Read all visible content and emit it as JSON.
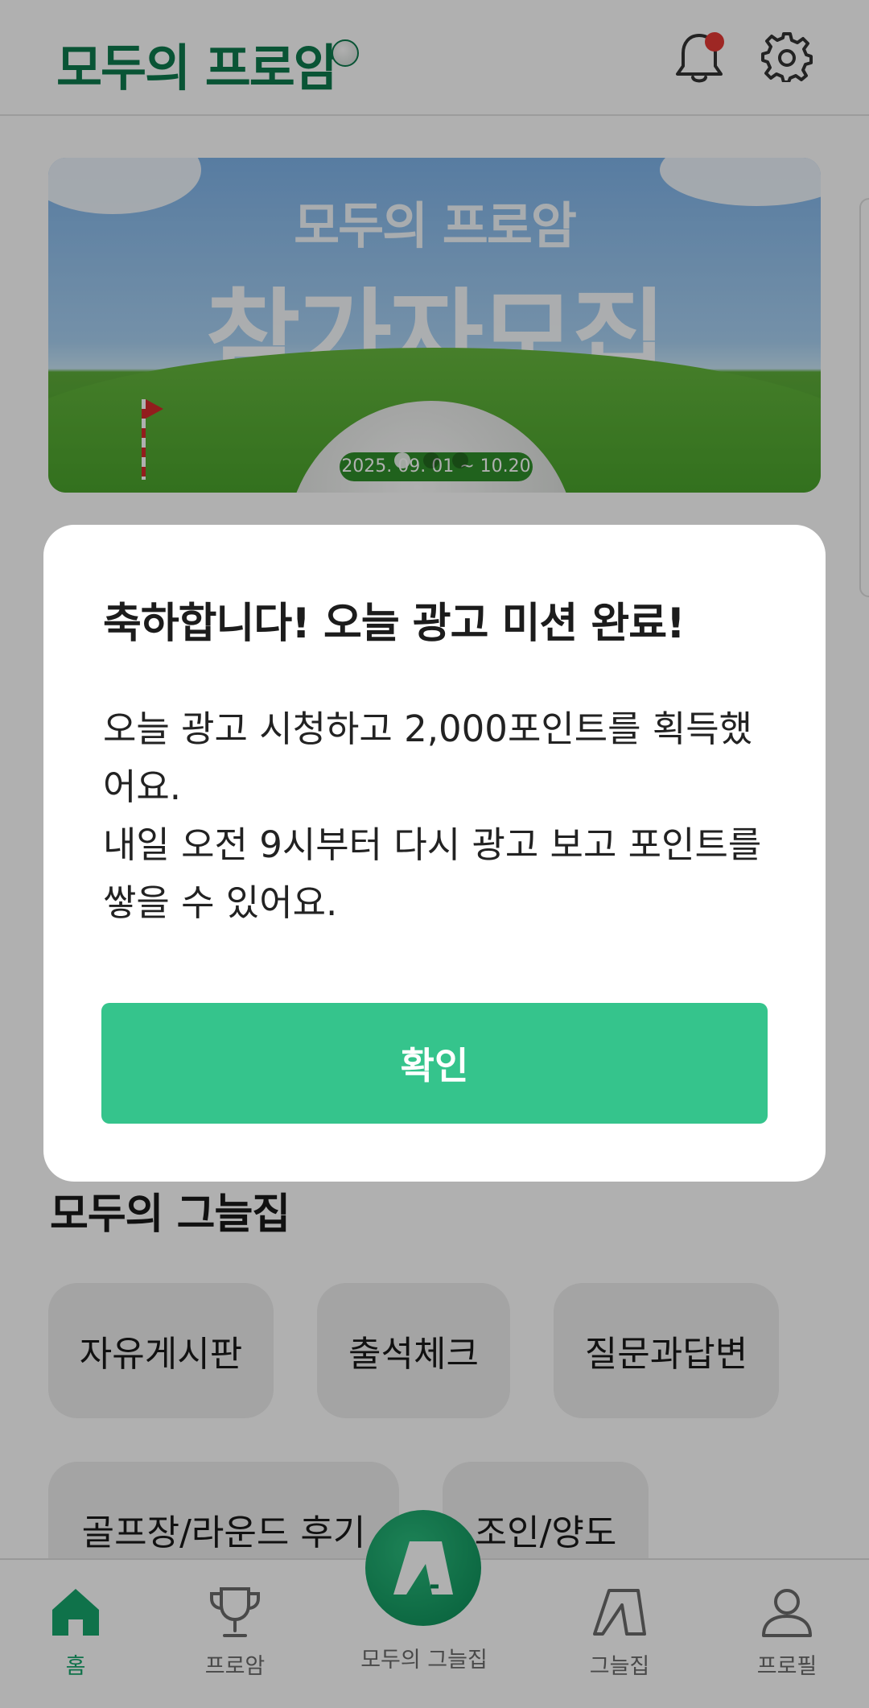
{
  "header": {
    "logo_text": "모두의 프로암",
    "icons": [
      "bell-icon",
      "gear-icon"
    ],
    "notification_dot_color": "#e53935"
  },
  "banner": {
    "subtitle": "모두의 프로암",
    "title": "참가자모집",
    "date": "2025. 09. 01 ~ 10.20",
    "carousel_total": 3,
    "carousel_active": 1
  },
  "community": {
    "title": "모두의 그늘집",
    "chips": [
      "자유게시판",
      "출석체크",
      "질문과답변",
      "골프장/라운드 후기",
      "조인/양도"
    ]
  },
  "bottom_nav": {
    "items": [
      {
        "label": "홈",
        "icon": "home-icon",
        "active": true
      },
      {
        "label": "프로암",
        "icon": "trophy-icon",
        "active": false
      },
      {
        "label": "모두의 그늘집",
        "icon": "shade-logo-icon",
        "active": false
      },
      {
        "label": "그늘집",
        "icon": "shade-tent-icon",
        "active": false
      },
      {
        "label": "프로필",
        "icon": "person-icon",
        "active": false
      }
    ]
  },
  "modal": {
    "title": "축하합니다! 오늘 광고 미션 완료!",
    "body_line1": "오늘 광고 시청하고 2,000포인트를 획득했어요.",
    "body_line2": "내일 오전 9시부터 다시 광고 보고 포인트를 쌓을 수 있어요.",
    "confirm_label": "확인"
  },
  "colors": {
    "brand_green": "#0e7a4e",
    "button_green": "#35c48c",
    "nav_active": "#17a56c",
    "overlay": "rgba(0,0,0,0.31)"
  }
}
